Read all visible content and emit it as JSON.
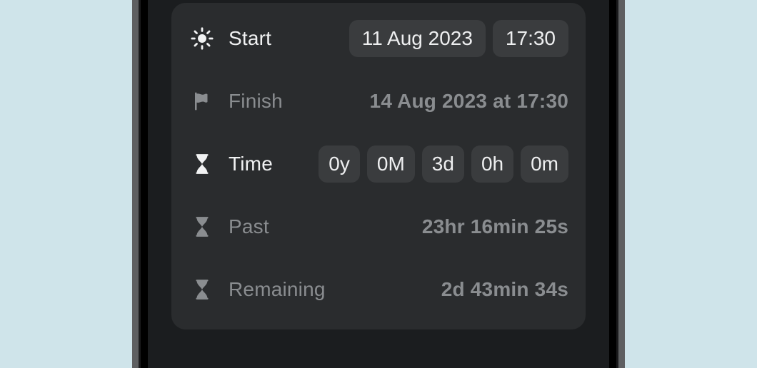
{
  "start": {
    "label": "Start",
    "date": "11 Aug 2023",
    "time": "17:30"
  },
  "finish": {
    "label": "Finish",
    "value": "14 Aug 2023 at 17:30"
  },
  "time": {
    "label": "Time",
    "parts": {
      "y": "0y",
      "M": "0M",
      "d": "3d",
      "h": "0h",
      "m": "0m"
    }
  },
  "past": {
    "label": "Past",
    "value": "23hr 16min 25s"
  },
  "remaining": {
    "label": "Remaining",
    "value": "2d 43min 34s"
  }
}
